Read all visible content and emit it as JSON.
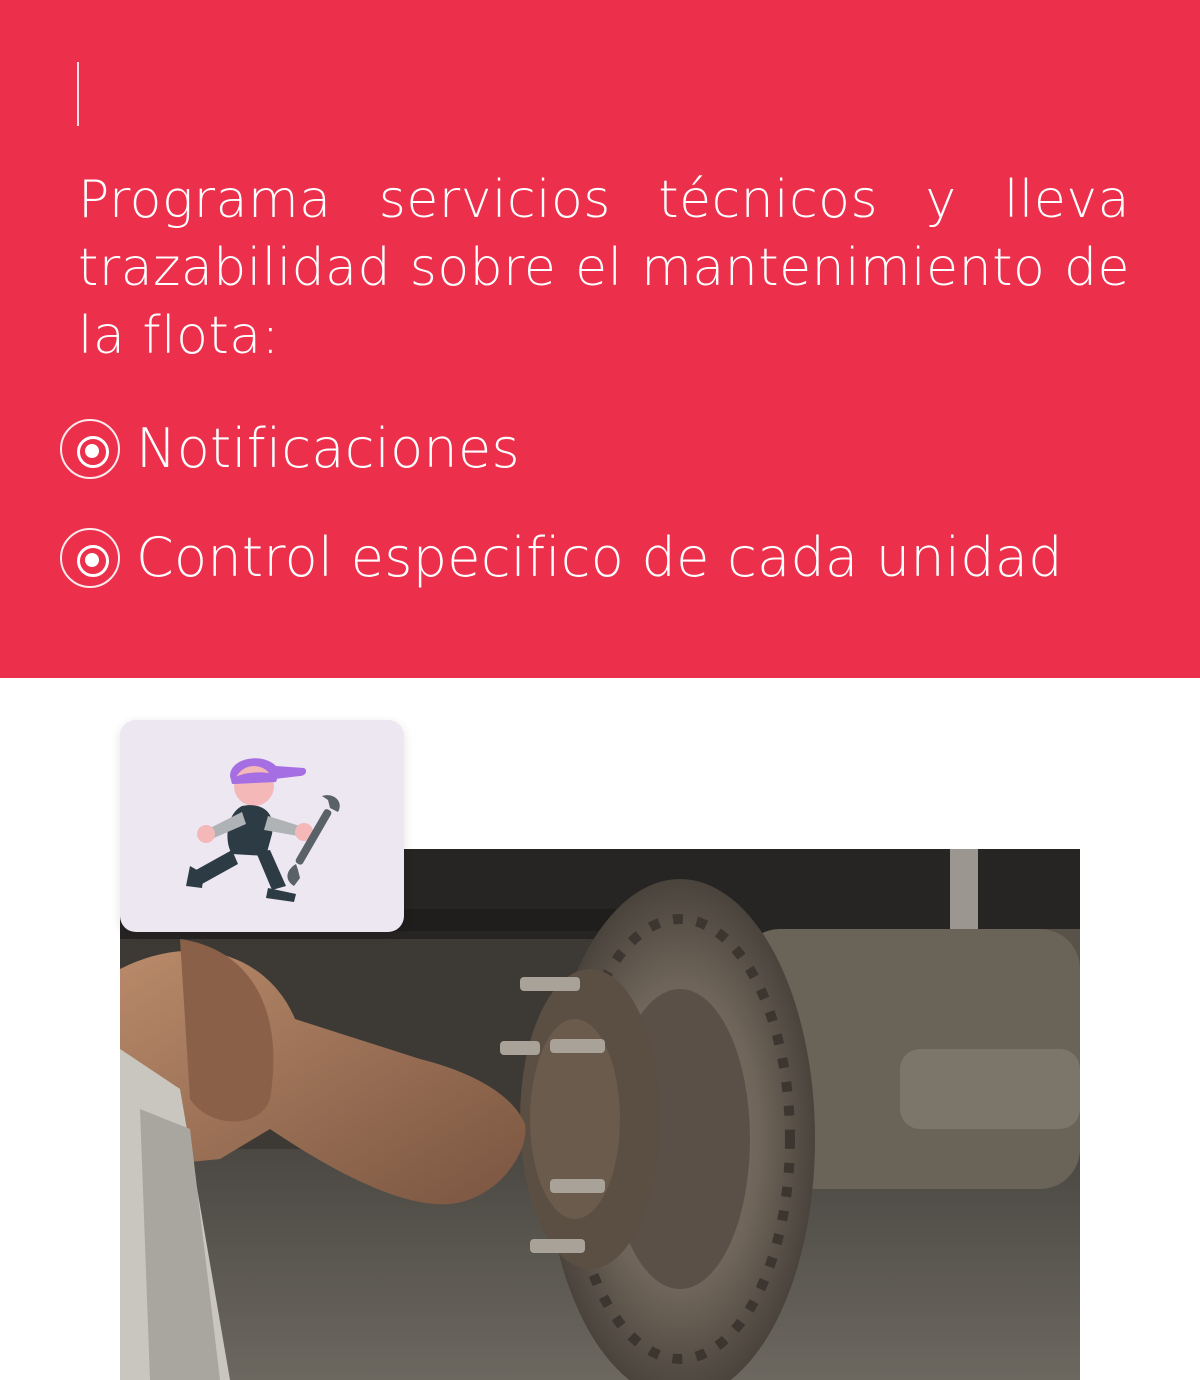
{
  "hero": {
    "headline": "Programa servicios técnicos y lleva trazabilidad sobre el mantenimiento de la flota:",
    "features": [
      {
        "label": "Notificaciones",
        "icon": "radio-target-icon"
      },
      {
        "label": "Control especifico de cada unidad",
        "icon": "radio-target-icon"
      }
    ],
    "background_color": "#ec2f4b"
  },
  "icon_card": {
    "icon": "mechanic-icon",
    "background_color": "#ece7f1"
  },
  "photo": {
    "subject": "mechanic-hand-brake-disc-photo"
  }
}
